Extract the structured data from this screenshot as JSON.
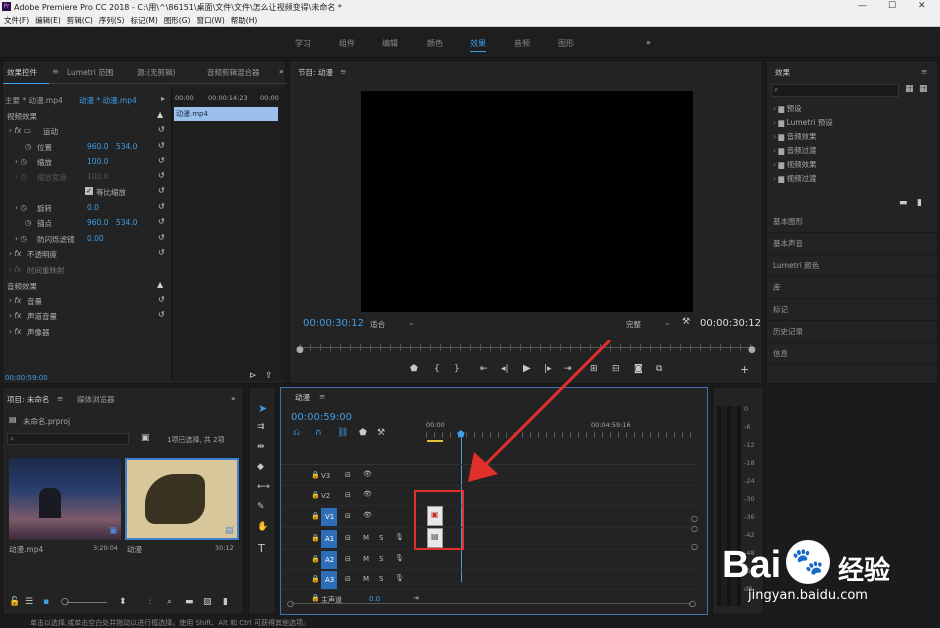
{
  "app": {
    "title": "Adobe Premiere Pro CC 2018 - C:\\用\\^\\86151\\桌面\\文件\\文件\\怎么让视频变得\\未命名 *"
  },
  "window_controls": {
    "minimize": "—",
    "maximize": "☐",
    "close": "✕"
  },
  "menu": [
    "文件(F)",
    "编辑(E)",
    "剪辑(C)",
    "序列(S)",
    "标记(M)",
    "图形(G)",
    "窗口(W)",
    "帮助(H)"
  ],
  "workspaces": [
    "学习",
    "组件",
    "编辑",
    "颜色",
    "效果",
    "音频",
    "图形"
  ],
  "workspaces_more": "»",
  "effect_controls": {
    "tabs": [
      "效果控件",
      "Lumetri 范围",
      "源:(无剪辑)",
      "音频剪辑混合器"
    ],
    "more": "»",
    "master": "主要 * 动漫.mp4",
    "clip": "动漫 * 动漫.mp4",
    "timecodes": [
      "00:00",
      "00:00:14:23",
      "00:00"
    ],
    "clip_bar": "动漫.mp4",
    "video_header": "视频效果",
    "motion": "运动",
    "position": {
      "label": "位置",
      "x": "960.0",
      "y": "534.0"
    },
    "scale": {
      "label": "缩放",
      "value": "100.0"
    },
    "scale_width": {
      "label": "缩放宽度",
      "value": "100.0"
    },
    "uniform": "等比缩放",
    "rotation": {
      "label": "旋转",
      "value": "0.0"
    },
    "anchor": {
      "label": "锚点",
      "x": "960.0",
      "y": "534.0"
    },
    "antiflicker": {
      "label": "防闪烁滤镜",
      "value": "0.00"
    },
    "opacity": "不透明度",
    "time_remap": "时间重映射",
    "audio_header": "音频效果",
    "volume": "音量",
    "channel_volume": "声道音量",
    "panner": "声像器",
    "timecode": "00:00:59:00"
  },
  "program": {
    "title": "节目: 动漫",
    "menu_icon": "≡",
    "timecode_left": "00:00:30:12",
    "fit": "适合",
    "quality": "完整",
    "timecode_right": "00:00:30:12"
  },
  "project": {
    "tabs": [
      "项目: 未命名",
      "媒体浏览器"
    ],
    "more": "»",
    "filename": "未命名.prproj",
    "selection": "1项已选择, 共 2项",
    "search_placeholder": "",
    "items": [
      {
        "name": "动漫.mp4",
        "duration": "3:20:04"
      },
      {
        "name": "动漫",
        "duration": "30:12"
      }
    ]
  },
  "timeline": {
    "title": "动漫",
    "menu_icon": "≡",
    "timecode": "00:00:59:00",
    "ruler": [
      "00:00",
      "00:04:59:16"
    ],
    "tracks": [
      {
        "name": "V3",
        "lock": "🔒",
        "kind": "video"
      },
      {
        "name": "V2",
        "lock": "🔒",
        "kind": "video"
      },
      {
        "name": "V1",
        "lock": "🔒",
        "kind": "video",
        "active": true
      },
      {
        "name": "A1",
        "lock": "🔒",
        "kind": "audio",
        "active": true,
        "m": "M",
        "s": "S"
      },
      {
        "name": "A2",
        "lock": "🔒",
        "kind": "audio",
        "m": "M",
        "s": "S"
      },
      {
        "name": "A3",
        "lock": "🔒",
        "kind": "audio",
        "m": "M",
        "s": "S"
      }
    ],
    "master": {
      "label": "主声道",
      "value": "0.0"
    }
  },
  "effects": {
    "title": "效果",
    "menu_icon": "≡",
    "folders": [
      "预设",
      "Lumetri 预设",
      "音频效果",
      "音频过渡",
      "视频效果",
      "视频过渡"
    ],
    "panels": [
      "基本图形",
      "基本声音",
      "Lumetri 颜色",
      "库",
      "标记",
      "历史记录",
      "信息"
    ]
  },
  "meter": {
    "ticks": [
      "0",
      "-6",
      "-12",
      "-18",
      "-24",
      "-30",
      "-36",
      "-42",
      "-48",
      "-54",
      "dB"
    ]
  },
  "statusbar": "单击以选择,或单击空白处并拖动以进行框选择。使用 Shift、Alt 和 Ctrl 可获得其他选项。",
  "watermark": {
    "brand": "Bai",
    "brand2": "经验",
    "url": "jingyan.baidu.com"
  }
}
